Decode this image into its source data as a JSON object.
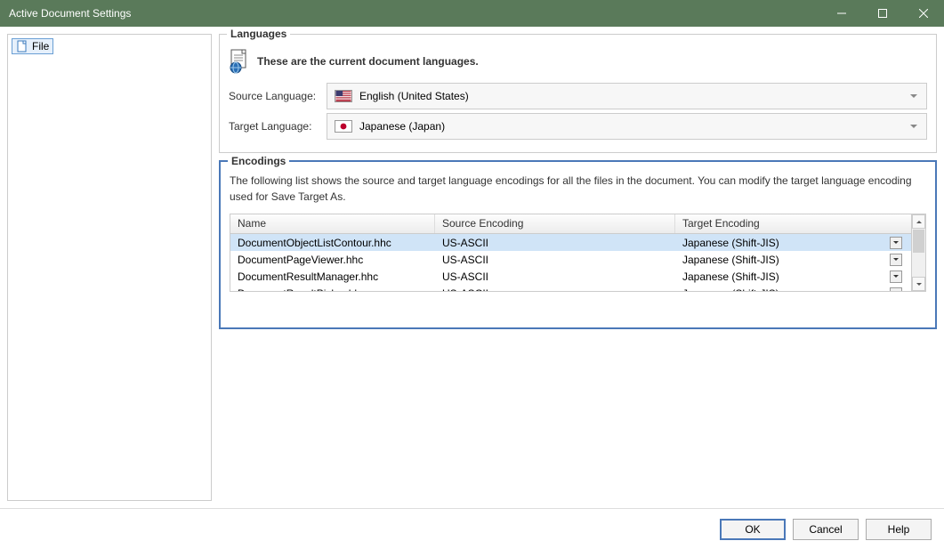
{
  "window": {
    "title": "Active Document Settings"
  },
  "tree": {
    "item": "File"
  },
  "languages": {
    "groupTitle": "Languages",
    "desc": "These are the current document languages.",
    "sourceLabel": "Source Language:",
    "sourceValue": "English (United States)",
    "targetLabel": "Target Language:",
    "targetValue": "Japanese (Japan)"
  },
  "encodings": {
    "groupTitle": "Encodings",
    "desc": "The following list shows the source and target language encodings for all the files in the document. You can modify the target language encoding used for Save Target As.",
    "columns": {
      "name": "Name",
      "source": "Source Encoding",
      "target": "Target Encoding"
    },
    "rows": [
      {
        "name": "DocumentObjectListContour.hhc",
        "source": "US-ASCII",
        "target": "Japanese (Shift-JIS)",
        "selected": true
      },
      {
        "name": "DocumentPageViewer.hhc",
        "source": "US-ASCII",
        "target": "Japanese (Shift-JIS)",
        "selected": false
      },
      {
        "name": "DocumentResultManager.hhc",
        "source": "US-ASCII",
        "target": "Japanese (Shift-JIS)",
        "selected": false
      },
      {
        "name": "DocumentResultPicker.hhc",
        "source": "US-ASCII",
        "target": "Japanese (Shift-JIS)",
        "selected": false
      }
    ]
  },
  "buttons": {
    "ok": "OK",
    "cancel": "Cancel",
    "help": "Help"
  }
}
